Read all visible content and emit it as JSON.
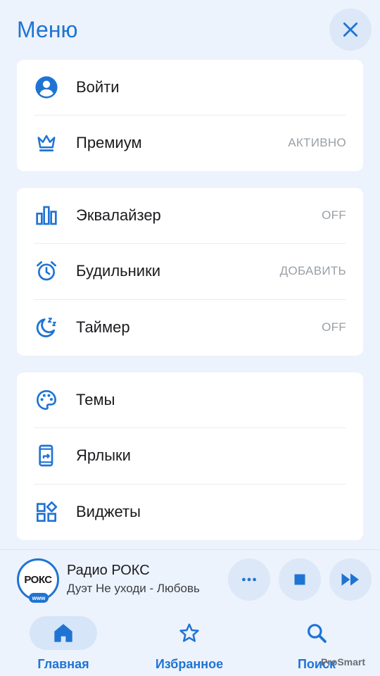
{
  "header": {
    "title": "Меню"
  },
  "account_card": [
    {
      "label": "Войти",
      "value": "",
      "icon": "account-circle-icon"
    },
    {
      "label": "Премиум",
      "value": "АКТИВНО",
      "icon": "crown-icon"
    }
  ],
  "tools_card": [
    {
      "label": "Эквалайзер",
      "value": "OFF",
      "icon": "equalizer-icon"
    },
    {
      "label": "Будильники",
      "value": "ДОБАВИТЬ",
      "icon": "alarm-clock-icon"
    },
    {
      "label": "Таймер",
      "value": "OFF",
      "icon": "sleep-timer-icon"
    }
  ],
  "appearance_card": [
    {
      "label": "Темы",
      "icon": "palette-icon"
    },
    {
      "label": "Ярлыки",
      "icon": "shortcut-phone-icon"
    },
    {
      "label": "Виджеты",
      "icon": "widgets-icon"
    }
  ],
  "player": {
    "station": "Радио РОКС",
    "track": "Дуэт Не уходи - Любовь",
    "logo_text": "РОКС",
    "logo_badge": "www"
  },
  "nav": [
    {
      "label": "Главная",
      "icon": "home-icon",
      "active": true
    },
    {
      "label": "Избранное",
      "icon": "star-outline-icon",
      "active": false
    },
    {
      "label": "Поиск",
      "icon": "search-icon",
      "active": false
    }
  ],
  "watermark": {
    "part1": "Pro",
    "part2": "Smart"
  },
  "colors": {
    "accent": "#1f74d3",
    "background": "#edf3fc",
    "card": "#ffffff",
    "muted": "#9aa0a6"
  }
}
